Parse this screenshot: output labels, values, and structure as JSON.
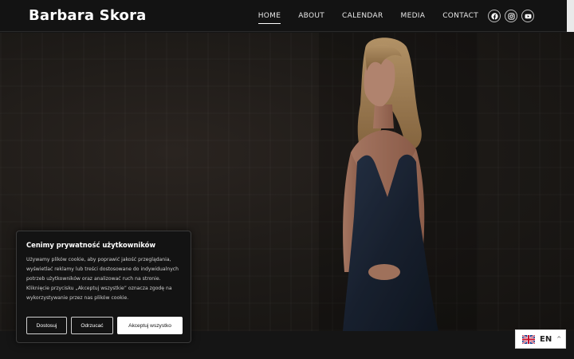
{
  "site": {
    "brand": "Barbara Skora"
  },
  "nav": {
    "items": [
      {
        "label": "HOME",
        "active": true
      },
      {
        "label": "ABOUT",
        "active": false
      },
      {
        "label": "CALENDAR",
        "active": false
      },
      {
        "label": "MEDIA",
        "active": false
      },
      {
        "label": "CONTACT",
        "active": false
      }
    ]
  },
  "socials": [
    "facebook-icon",
    "instagram-icon",
    "youtube-icon"
  ],
  "cookie": {
    "title": "Cenimy prywatność użytkowników",
    "body": "Używamy plików cookie, aby poprawić jakość przeglądania, wyświetlać reklamy lub treści dostosowane do indywidualnych potrzeb użytkowników oraz analizować ruch na stronie. Kliknięcie przycisku „Akceptuj wszystkie” oznacza zgodę na wykorzystywanie przez nas plików cookie.",
    "customize": "Dostosuj",
    "reject": "Odrzucać",
    "accept": "Akceptuj wszystko"
  },
  "language": {
    "code": "EN",
    "flag": "uk-flag-icon",
    "caret": "^"
  },
  "colors": {
    "background": "#151515",
    "header": "#131313",
    "text": "#ffffff"
  }
}
